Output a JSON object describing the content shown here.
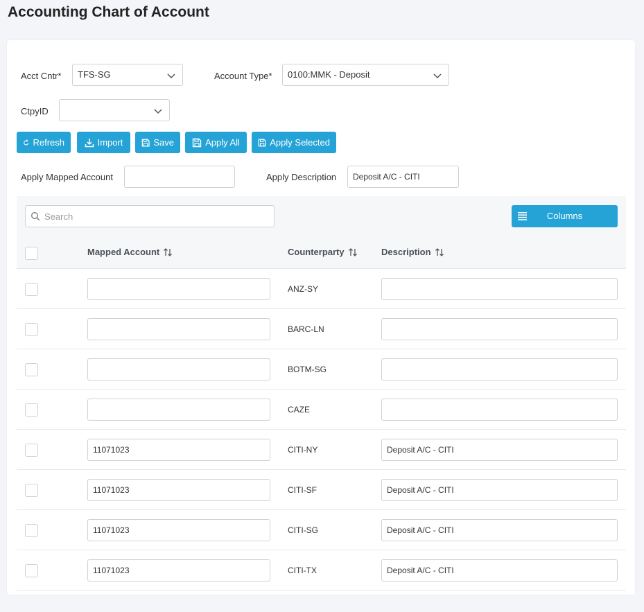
{
  "page": {
    "title": "Accounting Chart of Account"
  },
  "filters": {
    "acct_cntr_label": "Acct Cntr*",
    "acct_cntr_value": "TFS-SG",
    "account_type_label": "Account Type*",
    "account_type_value": "0100:MMK - Deposit",
    "ctpy_label": "CtpyID",
    "ctpy_value": ""
  },
  "toolbar": {
    "refresh": "Refresh",
    "import": "Import",
    "save": "Save",
    "apply_all": "Apply All",
    "apply_selected": "Apply Selected"
  },
  "apply": {
    "mapped_label": "Apply Mapped Account",
    "mapped_value": "",
    "desc_label": "Apply Description",
    "desc_value": "Deposit A/C - CITI"
  },
  "grid": {
    "search_placeholder": "Search",
    "columns_label": "Columns",
    "headers": [
      "Mapped Account",
      "Counterparty",
      "Description"
    ],
    "rows": [
      {
        "mapped": "",
        "counterparty": "ANZ-SY",
        "description": ""
      },
      {
        "mapped": "",
        "counterparty": "BARC-LN",
        "description": ""
      },
      {
        "mapped": "",
        "counterparty": "BOTM-SG",
        "description": ""
      },
      {
        "mapped": "",
        "counterparty": "CAZE",
        "description": ""
      },
      {
        "mapped": "11071023",
        "counterparty": "CITI-NY",
        "description": "Deposit A/C - CITI"
      },
      {
        "mapped": "11071023",
        "counterparty": "CITI-SF",
        "description": "Deposit A/C - CITI"
      },
      {
        "mapped": "11071023",
        "counterparty": "CITI-SG",
        "description": "Deposit A/C - CITI"
      },
      {
        "mapped": "11071023",
        "counterparty": "CITI-TX",
        "description": "Deposit A/C - CITI"
      }
    ]
  },
  "colors": {
    "accent": "#25a3d6",
    "background": "#f3f5f8"
  }
}
